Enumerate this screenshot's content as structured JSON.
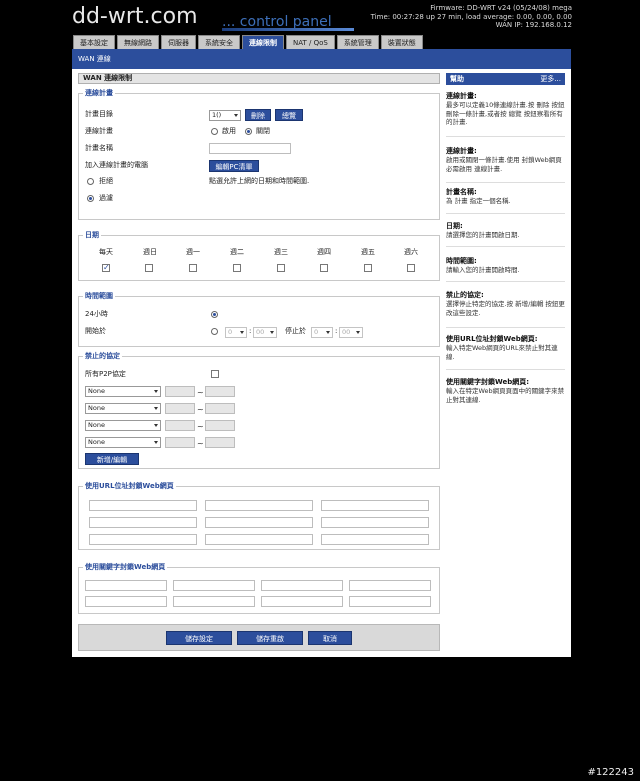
{
  "header": {
    "logo_main": "dd-wrt.com",
    "logo_sub": "... control panel",
    "firmware": "Firmware: DD-WRT v24 (05/24/08) mega",
    "time": "Time: 00:27:28 up 27 min, load average: 0.00, 0.00, 0.00",
    "wan_ip": "WAN IP: 192.168.0.12"
  },
  "tabs": [
    {
      "label": "基本設定"
    },
    {
      "label": "無線網路"
    },
    {
      "label": "伺服器"
    },
    {
      "label": "系統安全"
    },
    {
      "label": "連線限制"
    },
    {
      "label": "NAT / QoS"
    },
    {
      "label": "系統管理"
    },
    {
      "label": "裝置狀態"
    }
  ],
  "subtab": "WAN 連線",
  "section_title": "WAN 連線限制",
  "policy": {
    "legend": "連線計畫",
    "row1_label": "計畫目錄",
    "select_value": "1()",
    "delete_btn": "刪除",
    "summary_btn": "總覽",
    "row2_label": "連線計畫",
    "enable": "啟用",
    "disable": "關閉",
    "row3_label": "計畫名稱",
    "row4_label": "加入連線計畫的電腦",
    "edit_pc_btn": "編輯PC清單",
    "deny": "拒絕",
    "filter": "過濾",
    "note": "點選允許上網的日期和時間範圍."
  },
  "days": {
    "legend": "日期",
    "labels": [
      "每天",
      "週日",
      "週一",
      "週二",
      "週三",
      "週四",
      "週五",
      "週六"
    ]
  },
  "times": {
    "legend": "時間範圍",
    "allday": "24小時",
    "from": "開始於",
    "to": "停止於",
    "h1": "0",
    "m1": "00",
    "h2": "0",
    "m2": "00"
  },
  "blocked": {
    "legend": "禁止的協定",
    "p2p": "所有P2P協定",
    "rows": [
      {
        "value": "None"
      },
      {
        "value": "None"
      },
      {
        "value": "None"
      },
      {
        "value": "None"
      }
    ],
    "add_btn": "新增/編輯"
  },
  "url_block": {
    "legend": "使用URL位址封鎖Web網頁"
  },
  "kw_block": {
    "legend": "使用關鍵字封鎖Web網頁"
  },
  "buttons": {
    "save": "儲存設定",
    "apply": "儲存重啟",
    "cancel": "取消"
  },
  "help": {
    "title": "幫助",
    "more": "更多...",
    "items": [
      {
        "title": "連線計畫:",
        "body": "最多可以定義10條連線計畫.按 刪除 按鈕刪除一條計畫,或者按 總覽 按鈕察看所有的計畫."
      },
      {
        "title": "連線計畫:",
        "body": "啟用或關閉一條計畫.使用 封鎖Web網頁 必需啟用 連線計畫."
      },
      {
        "title": "計畫名稱:",
        "body": "為 計畫 指定一個名稱."
      },
      {
        "title": "日期:",
        "body": "請選擇您的計畫開啟日期."
      },
      {
        "title": "時間範圍:",
        "body": "請輸入您的計畫開啟時間."
      },
      {
        "title": "禁止的協定:",
        "body": "選擇停止特定的協定.按 新增/編輯 按鈕更改這些設定."
      },
      {
        "title": "使用URL位址封鎖Web網頁:",
        "body": "輸入特定Web網頁的URL來禁止對其連線."
      },
      {
        "title": "使用關鍵字封鎖Web網頁:",
        "body": "輸入在特定Web網頁頁面中的關鍵字來禁止對其連線."
      }
    ]
  },
  "watermark": "#122243"
}
